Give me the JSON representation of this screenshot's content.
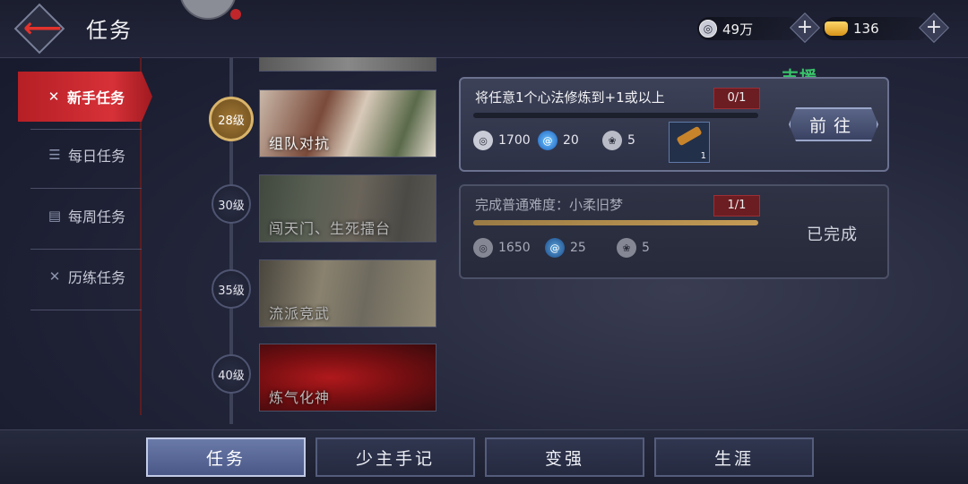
{
  "header": {
    "title": "任务",
    "silver": "49万",
    "gold": "136"
  },
  "sidebar": {
    "items": [
      {
        "label": "新手任务",
        "icon": "butterfly-icon",
        "active": true
      },
      {
        "label": "每日任务",
        "icon": "scroll-icon",
        "active": false
      },
      {
        "label": "每周任务",
        "icon": "book-icon",
        "active": false
      },
      {
        "label": "历练任务",
        "icon": "butterfly-icon",
        "active": false
      }
    ]
  },
  "timeline": {
    "stages": [
      {
        "level": "28级",
        "caption": "组队对抗",
        "current": true
      },
      {
        "level": "30级",
        "caption": "闯天门、生死擂台",
        "current": false
      },
      {
        "level": "35级",
        "caption": "流派竞武",
        "current": false
      },
      {
        "level": "40级",
        "caption": "炼气化神",
        "current": false
      }
    ]
  },
  "tasks": [
    {
      "description": "将任意1个心法修炼到+1或以上",
      "progress": "0/1",
      "progress_fraction": 0,
      "rewards": [
        "1700",
        "20",
        "5"
      ],
      "item_count": "1",
      "action": "前往"
    },
    {
      "description": "完成普通难度：小柔旧梦",
      "progress": "1/1",
      "progress_fraction": 1,
      "rewards": [
        "1650",
        "25",
        "5"
      ],
      "status": "已完成"
    }
  ],
  "support_label": "支援",
  "bottom_nav": [
    "任务",
    "少主手记",
    "变强",
    "生涯"
  ],
  "colors": {
    "accent_red": "#d73138",
    "support_green": "#39c46a",
    "gold": "#d9b46a"
  }
}
